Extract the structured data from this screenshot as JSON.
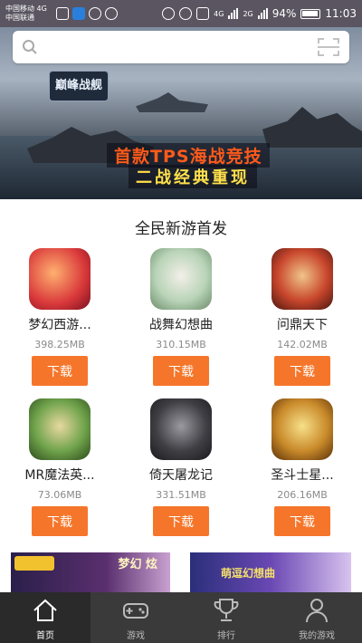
{
  "status_bar": {
    "carrier1": "中国移动 4G",
    "carrier2": "中国联通",
    "network": "4G",
    "network2": "2G",
    "battery": "94%",
    "time": "11:03"
  },
  "search": {
    "placeholder": ""
  },
  "banner": {
    "logo": "巅峰战舰",
    "headline": "首款TPS海战竞技",
    "subline": "二战经典重现"
  },
  "section": {
    "title": "全民新游首发",
    "games": [
      {
        "name": "梦幻西游...",
        "size": "398.25MB",
        "button": "下载",
        "color": "#d9383a"
      },
      {
        "name": "战舞幻想曲",
        "size": "310.15MB",
        "button": "下载",
        "color": "#b9d4b8"
      },
      {
        "name": "问鼎天下",
        "size": "142.02MB",
        "button": "下载",
        "color": "#c8462c"
      },
      {
        "name": "MR魔法英...",
        "size": "73.06MB",
        "button": "下载",
        "color": "#6fa34b"
      },
      {
        "name": "倚天屠龙记",
        "size": "331.51MB",
        "button": "下载",
        "color": "#3f3f44"
      },
      {
        "name": "圣斗士星...",
        "size": "206.16MB",
        "button": "下载",
        "color": "#c98a2a"
      }
    ]
  },
  "bottom_banners": {
    "left_text": "梦幻 炫",
    "right_text": "萌逗幻想曲"
  },
  "tabbar": {
    "tabs": [
      {
        "label": "首页",
        "icon": "home-icon"
      },
      {
        "label": "游戏",
        "icon": "gamepad-icon"
      },
      {
        "label": "排行",
        "icon": "trophy-icon"
      },
      {
        "label": "我的游戏",
        "icon": "user-icon"
      }
    ]
  },
  "colors": {
    "accent": "#f5762a",
    "tabbar": "#3a3a3a"
  }
}
